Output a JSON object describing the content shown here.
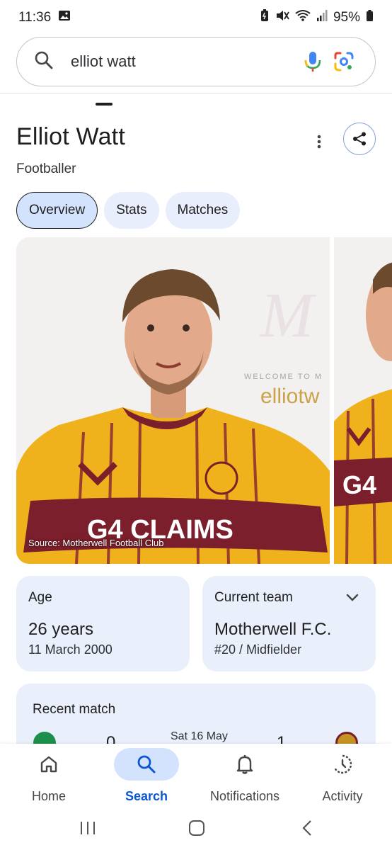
{
  "status_bar": {
    "time": "11:36",
    "battery": "95%"
  },
  "search": {
    "query": "elliot watt"
  },
  "entity": {
    "title": "Elliot Watt",
    "subtitle": "Footballer"
  },
  "tabs": [
    {
      "label": "Overview",
      "active": true
    },
    {
      "label": "Stats",
      "active": false
    },
    {
      "label": "Matches",
      "active": false
    }
  ],
  "image": {
    "source_caption": "Source: Motherwell Football Club",
    "backdrop_text_1": "WELCOME TO M",
    "backdrop_text_2": "elliotw",
    "sponsor_text": "G4 CLAIMS",
    "side_sponsor_text": "G4"
  },
  "age_card": {
    "label": "Age",
    "value": "26 years",
    "detail": "11 March 2000"
  },
  "team_card": {
    "label": "Current team",
    "value": "Motherwell F.C.",
    "detail": "#20 / Midfielder"
  },
  "recent_match": {
    "title": "Recent match",
    "date": "Sat 16 May",
    "home_score": "0",
    "away_score": "1"
  },
  "bottom_nav": [
    {
      "label": "Home",
      "icon": "home-icon",
      "active": false
    },
    {
      "label": "Search",
      "icon": "search-icon",
      "active": true
    },
    {
      "label": "Notifications",
      "icon": "bell-icon",
      "active": false
    },
    {
      "label": "Activity",
      "icon": "history-icon",
      "active": false
    }
  ],
  "colors": {
    "accent": "#0b57d0",
    "chip_active": "#d3e3fd",
    "card_bg": "#e9effb",
    "kit_amber": "#f1b41e",
    "kit_claret": "#7a1f2b"
  }
}
